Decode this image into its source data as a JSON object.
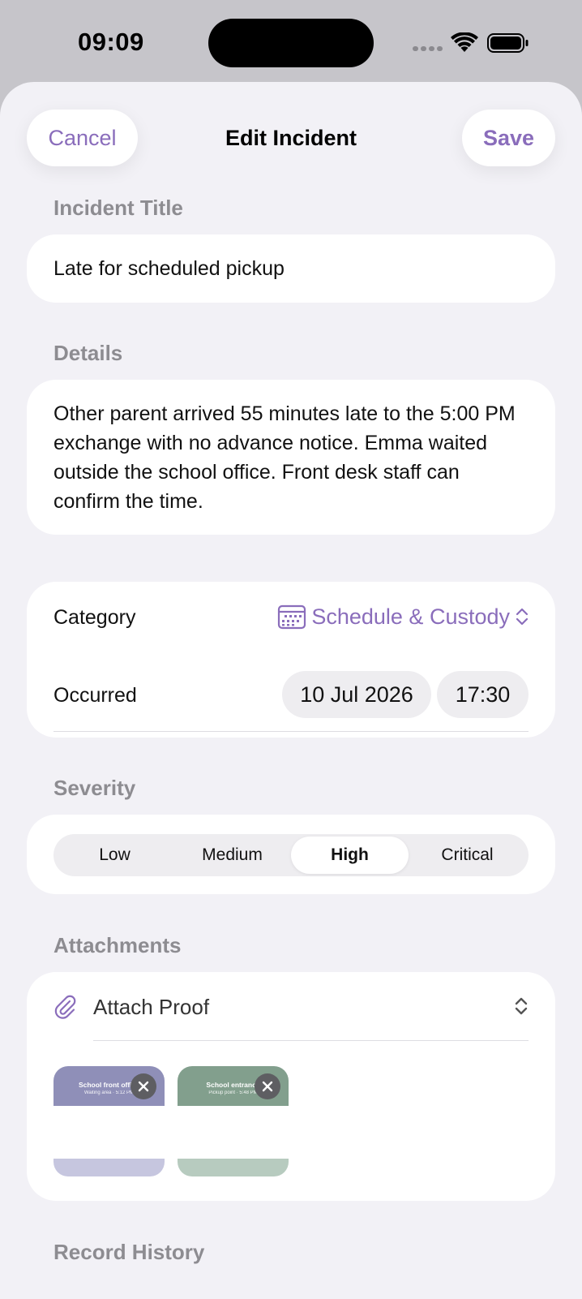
{
  "status": {
    "time": "09:09"
  },
  "nav": {
    "cancel_label": "Cancel",
    "title": "Edit Incident",
    "save_label": "Save"
  },
  "form": {
    "title_label": "Incident Title",
    "title_value": "Late for scheduled pickup",
    "details_label": "Details",
    "details_value": "Other parent arrived 55 minutes late to the 5:00 PM exchange with no advance notice. Emma waited outside the school office. Front desk staff can confirm the time.",
    "category_label": "Category",
    "category_value": "Schedule & Custody",
    "occurred_label": "Occurred",
    "occurred_date": "10 Jul 2026",
    "occurred_time": "17:30"
  },
  "severity": {
    "label": "Severity",
    "options": [
      "Low",
      "Medium",
      "High",
      "Critical"
    ],
    "selected": "High"
  },
  "attachments": {
    "label": "Attachments",
    "attach_label": "Attach Proof",
    "items": [
      {
        "title": "School front office",
        "subtitle": "Waiting area · 5:12 PM"
      },
      {
        "title": "School entrance",
        "subtitle": "Pickup point · 5:48 PM"
      }
    ]
  },
  "history": {
    "label": "Record History"
  },
  "colors": {
    "accent": "#8a6dbb",
    "background": "#f2f1f6",
    "card": "#ffffff"
  },
  "icons": [
    "wifi-icon",
    "battery-icon",
    "calendar-icon",
    "chevron-up-down-icon",
    "paperclip-icon",
    "close-icon"
  ]
}
